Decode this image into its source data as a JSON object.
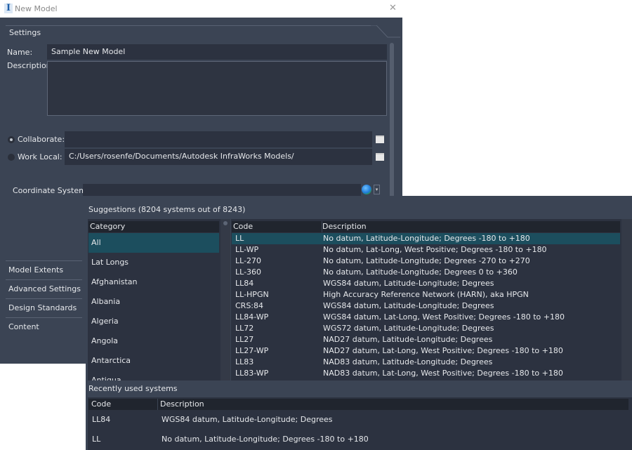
{
  "window": {
    "title": "New Model",
    "app_icon": "I",
    "close_glyph": "✕"
  },
  "settings": {
    "section_label": "Settings",
    "name_label": "Name:",
    "name_value": "Sample New Model",
    "description_label": "Description:",
    "description_value": "",
    "collaborate_label": "Collaborate:",
    "collaborate_value": "",
    "collaborate_selected": true,
    "work_local_label": "Work Local:",
    "work_local_value": "C:/Users/rosenfe/Documents/Autodesk InfraWorks Models/",
    "work_local_selected": false,
    "coordinate_system_label": "Coordinate System:",
    "coordinate_system_value": "",
    "dropdown_glyph": "▾"
  },
  "sidebar": {
    "items": [
      {
        "label": "Model Extents"
      },
      {
        "label": "Advanced Settings"
      },
      {
        "label": "Design Standards"
      },
      {
        "label": "Content"
      }
    ]
  },
  "suggestions": {
    "title": "Suggestions (8204 systems out of 8243)",
    "category_header": "Category",
    "categories": [
      {
        "label": "All",
        "selected": true
      },
      {
        "label": "Lat Longs"
      },
      {
        "label": "Afghanistan"
      },
      {
        "label": "Albania"
      },
      {
        "label": "Algeria"
      },
      {
        "label": "Angola"
      },
      {
        "label": "Antarctica"
      },
      {
        "label": "Antigua"
      }
    ],
    "code_header": "Code",
    "description_header": "Description",
    "rows": [
      {
        "code": "LL",
        "description": "No datum, Latitude-Longitude; Degrees -180 to +180",
        "selected": true
      },
      {
        "code": "LL-WP",
        "description": "No datum, Lat-Long, West Positive; Degrees -180 to +180"
      },
      {
        "code": "LL-270",
        "description": "No datum, Latitude-Longitude; Degrees -270 to +270"
      },
      {
        "code": "LL-360",
        "description": "No datum, Latitude-Longitude; Degrees 0 to +360"
      },
      {
        "code": "LL84",
        "description": "WGS84 datum, Latitude-Longitude; Degrees"
      },
      {
        "code": "LL-HPGN",
        "description": "High Accuracy Reference Network (HARN), aka HPGN"
      },
      {
        "code": "CRS:84",
        "description": "WGS84 datum, Latitude-Longitude; Degrees"
      },
      {
        "code": "LL84-WP",
        "description": "WGS84 datum, Lat-Long, West Positive; Degrees -180 to +180"
      },
      {
        "code": "LL72",
        "description": "WGS72 datum, Latitude-Longitude; Degrees"
      },
      {
        "code": "LL27",
        "description": "NAD27 datum, Latitude-Longitude; Degrees"
      },
      {
        "code": "LL27-WP",
        "description": "NAD27 datum, Lat-Long, West Positive; Degrees -180 to +180"
      },
      {
        "code": "LL83",
        "description": "NAD83 datum, Latitude-Longitude; Degrees"
      },
      {
        "code": "LL83-WP",
        "description": "NAD83 datum, Lat-Long, West Positive; Degrees -180 to +180"
      }
    ]
  },
  "recent": {
    "title": "Recently used systems",
    "code_header": "Code",
    "description_header": "Description",
    "rows": [
      {
        "code": "LL84",
        "description": "WGS84 datum, Latitude-Longitude; Degrees"
      },
      {
        "code": "LL",
        "description": "No datum, Latitude-Longitude; Degrees -180 to +180"
      }
    ]
  },
  "colors": {
    "dialog_bg": "#3b4454",
    "field_bg": "#2c3240",
    "selection": "#1c4e5e",
    "header_bg": "#20252e"
  }
}
